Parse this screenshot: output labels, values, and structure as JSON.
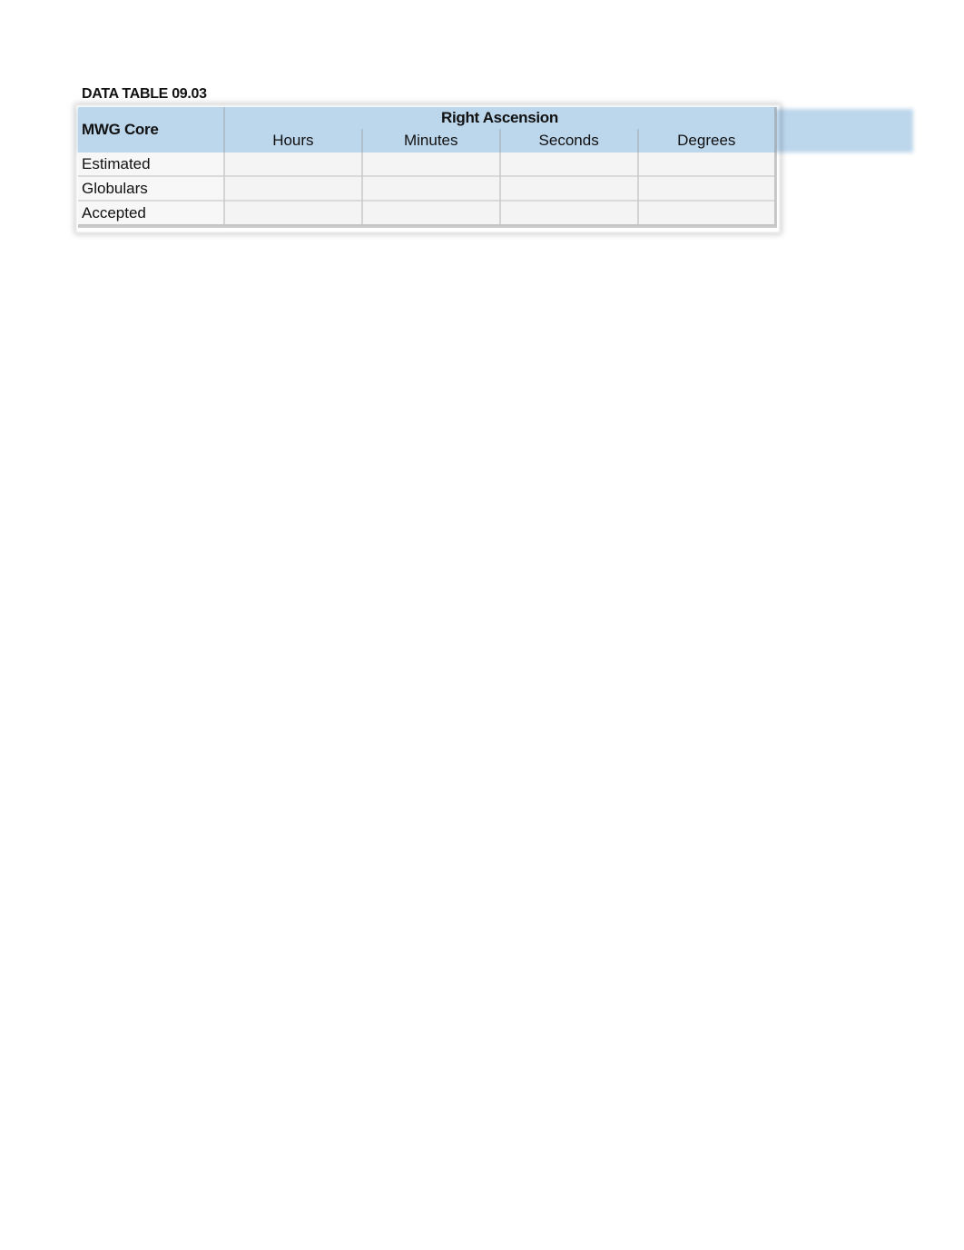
{
  "document": {
    "title": "DATA TABLE 09.03"
  },
  "table": {
    "row_header_label": "MWG Core",
    "group_header": "Right Ascension",
    "columns": [
      "Hours",
      "Minutes",
      "Seconds",
      "Degrees"
    ],
    "rows": [
      {
        "label": "Estimated",
        "values": [
          "",
          "",
          "",
          ""
        ]
      },
      {
        "label": "Globulars",
        "values": [
          "",
          "",
          "",
          ""
        ]
      },
      {
        "label": "Accepted",
        "values": [
          "",
          "",
          "",
          ""
        ]
      }
    ],
    "header_color": "#bcd6ec"
  }
}
